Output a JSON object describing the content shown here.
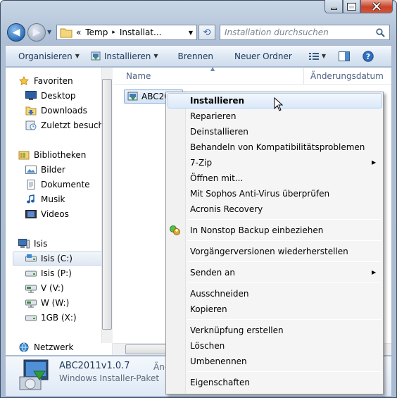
{
  "window": {
    "caption_buttons": [
      "minimize-icon",
      "maximize-icon",
      "close-icon"
    ]
  },
  "address": {
    "chevrons": "«",
    "segments": [
      "Temp",
      "Installat..."
    ],
    "separators": "▸"
  },
  "search": {
    "placeholder": "Installation durchsuchen"
  },
  "toolbar": {
    "organize": "Organisieren",
    "install": "Installieren",
    "burn": "Brennen",
    "new_folder": "Neuer Ordner"
  },
  "columns": {
    "name": "Name",
    "modified": "Änderungsdatum"
  },
  "sidebar": {
    "favorites": {
      "title": "Favoriten",
      "items": [
        "Desktop",
        "Downloads",
        "Zuletzt besucht"
      ]
    },
    "libraries": {
      "title": "Bibliotheken",
      "items": [
        "Bilder",
        "Dokumente",
        "Musik",
        "Videos"
      ]
    },
    "computer": {
      "title": "Isis",
      "items": [
        "Isis (C:)",
        "Isis (P:)",
        "V (V:)",
        "W (W:)",
        "1GB (X:)"
      ],
      "selected": "Isis (C:)"
    },
    "network": {
      "title": "Netzwerk"
    }
  },
  "file": {
    "name": "ABC20"
  },
  "details": {
    "name": "ABC2011v1.0.7",
    "type": "Windows Installer-Paket",
    "modified_truncated": "Änc"
  },
  "context_menu": {
    "items": [
      "Installieren",
      "Reparieren",
      "Deinstallieren",
      "Behandeln von Kompatibilitätsproblemen",
      "7-Zip",
      "Öffnen mit...",
      "Mit Sophos Anti-Virus überprüfen",
      "Acronis Recovery",
      "In Nonstop Backup einbeziehen",
      "Vorgängerversionen wiederherstellen",
      "Senden an",
      "Ausschneiden",
      "Kopieren",
      "Verknüpfung erstellen",
      "Löschen",
      "Umbenennen",
      "Eigenschaften"
    ],
    "highlighted": "Installieren"
  },
  "colors": {
    "accent": "#3399ff",
    "toolbar_text": "#1e395b"
  }
}
